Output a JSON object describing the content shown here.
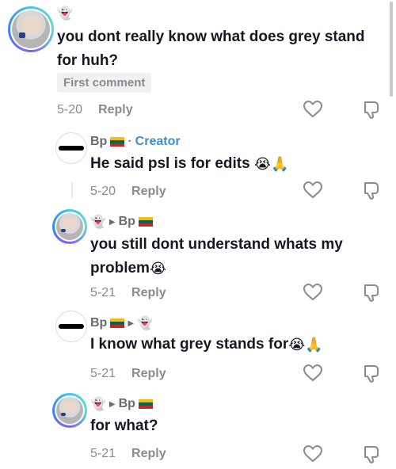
{
  "comments": [
    {
      "name": "",
      "text": "you dont really know what does grey stand for huh?",
      "date": "5-20",
      "reply": "Reply",
      "badge": "First comment"
    },
    {
      "name": "Bp",
      "tag": "Creator",
      "text": "He said psl is for edits",
      "emoji": "😭🙏",
      "date": "5-20",
      "reply": "Reply"
    },
    {
      "name": "Bp",
      "text": "you still dont understand whats my problem",
      "emoji": "😭",
      "date": "5-21",
      "reply": "Reply"
    },
    {
      "name": "Bp",
      "text": "I know what grey stands for",
      "emoji": "😭🙏",
      "date": "5-21",
      "reply": "Reply"
    },
    {
      "name": "Bp",
      "text": "for what?",
      "date": "5-21",
      "reply": "Reply"
    }
  ],
  "icons": {
    "like": "heart-outline-icon",
    "dislike": "thumbs-down-icon",
    "ghost": "ghost-emoji",
    "flag": "lithuania-flag"
  },
  "colors": {
    "creator": "#3d8fc7",
    "muted": "#8a8b91",
    "text": "#161823"
  }
}
